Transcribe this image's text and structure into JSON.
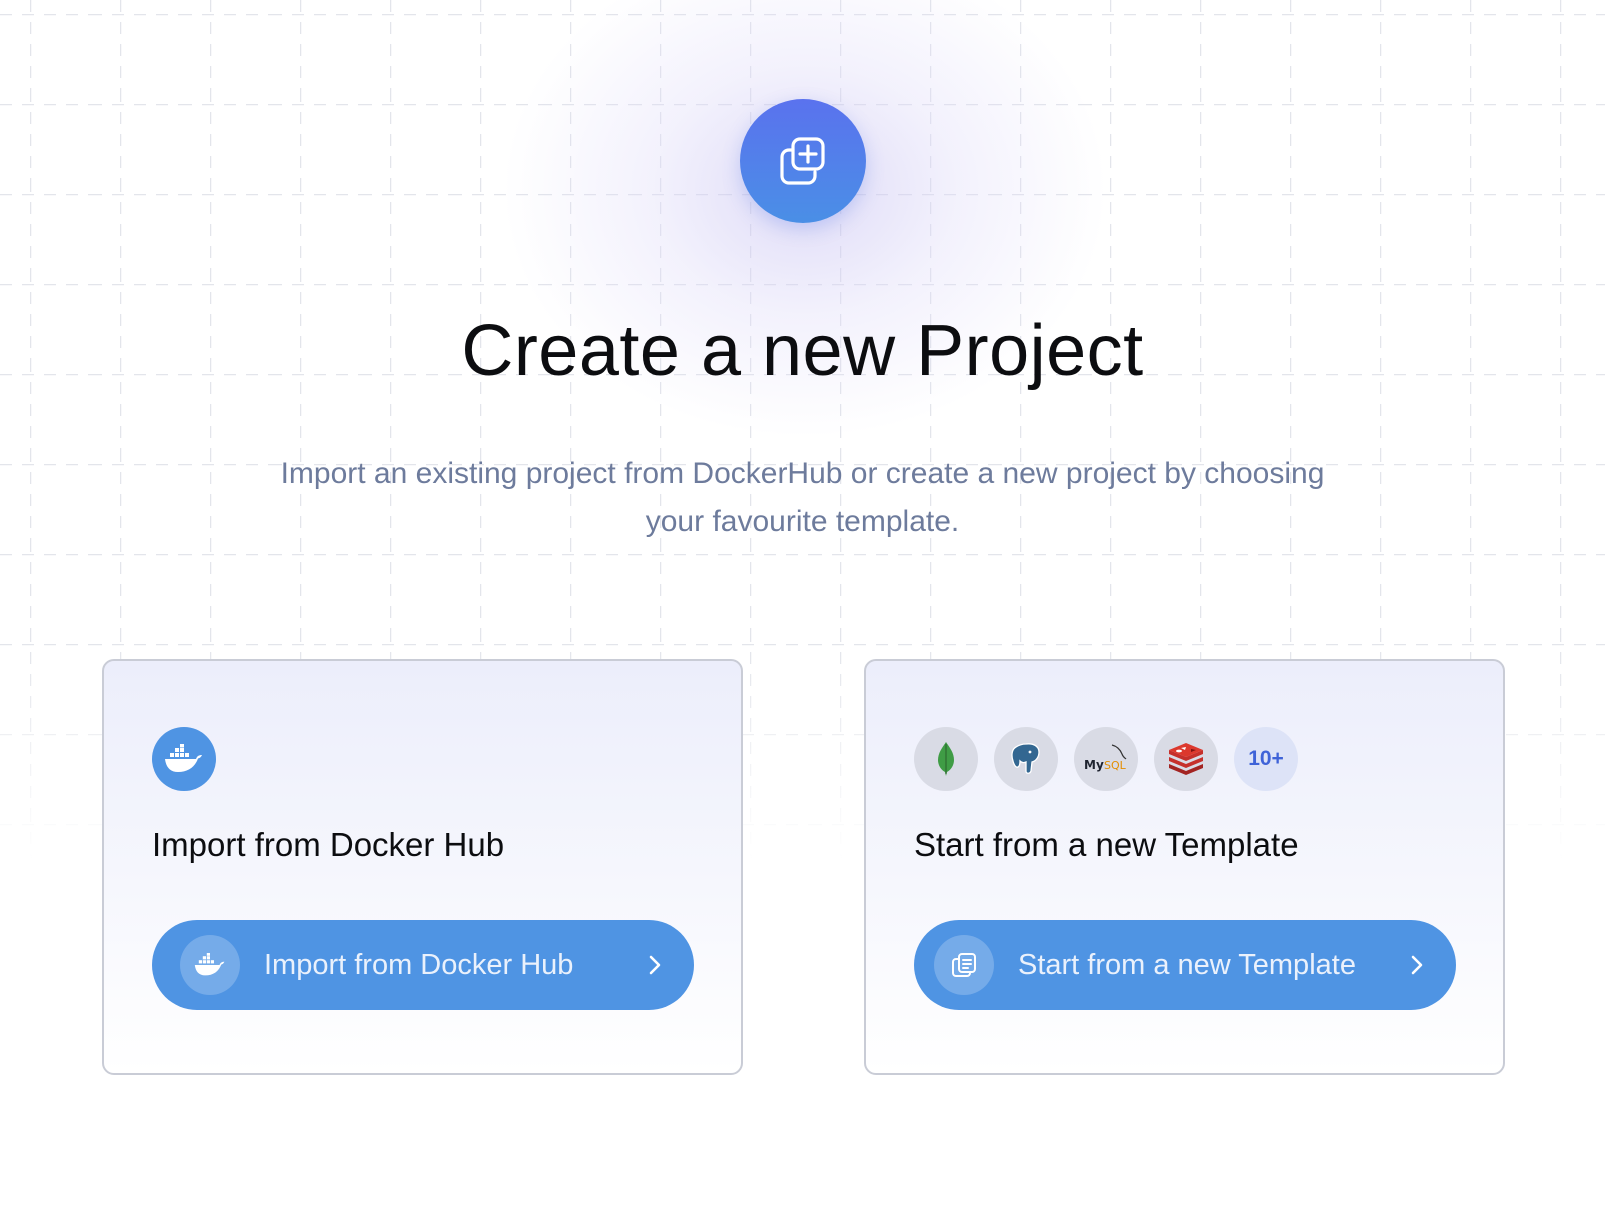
{
  "hero": {
    "title": "Create a new Project",
    "subtitle": "Import an existing project from DockerHub or create a new project by choosing your favourite template.",
    "icon": "copy-plus-icon"
  },
  "cards": {
    "docker": {
      "logo": "docker-icon",
      "title": "Import from Docker Hub",
      "button_label": "Import from Docker Hub",
      "button_icon": "docker-icon"
    },
    "template": {
      "logos": [
        "mongodb-icon",
        "postgresql-icon",
        "mysql-icon",
        "redis-icon"
      ],
      "more_label": "10+",
      "mysql_text": "MySQL",
      "title": "Start from a new Template",
      "button_label": "Start from a new Template",
      "button_icon": "template-icon"
    }
  },
  "colors": {
    "accent": "#4f94e3",
    "hero_gradient_top": "#5a72ee",
    "hero_gradient_bottom": "#4a8fe6",
    "subtitle": "#6d7b9c"
  }
}
